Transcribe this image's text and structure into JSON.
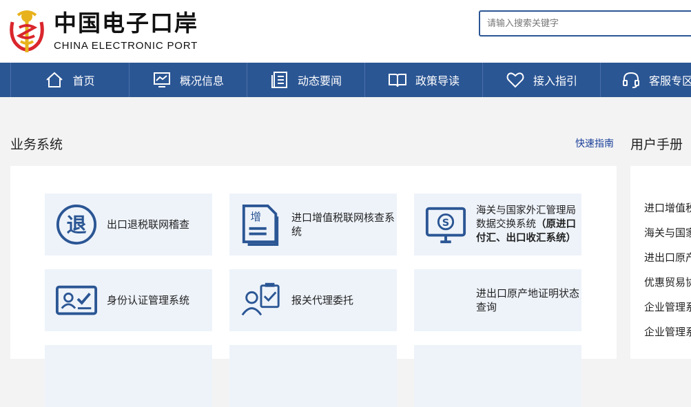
{
  "header": {
    "logo_cn": "中国电子口岸",
    "logo_en": "CHINA ELECTRONIC PORT",
    "search_placeholder": "请输入搜索关键字"
  },
  "nav": {
    "items": [
      {
        "label": "首页",
        "icon": "home-icon"
      },
      {
        "label": "概况信息",
        "icon": "chart-monitor-icon"
      },
      {
        "label": "动态要闻",
        "icon": "document-list-icon"
      },
      {
        "label": "政策导读",
        "icon": "open-book-icon"
      },
      {
        "label": "接入指引",
        "icon": "heart-icon"
      },
      {
        "label": "客服专区",
        "icon": "headset-icon"
      }
    ]
  },
  "business": {
    "title": "业务系统",
    "quick_link": "快速指南",
    "tiles": [
      {
        "label": "出口退税联网稽查",
        "icon": "tui-refund-icon"
      },
      {
        "label": "进口增值税联网核查系统",
        "icon": "vat-document-icon"
      },
      {
        "label_line1": "海关与国家外汇管理局数据交换系统",
        "label_bold": "（原进口付汇、出口收汇系统）",
        "icon": "monitor-currency-icon"
      },
      {
        "label": "身份认证管理系统",
        "icon": "id-card-check-icon"
      },
      {
        "label": "报关代理委托",
        "icon": "person-clipboard-icon"
      },
      {
        "label": "进出口原产地证明状态查询",
        "icon": ""
      }
    ]
  },
  "manual": {
    "title": "用户手册",
    "items": [
      "进口增值税",
      "海关与国家",
      "进出口原产",
      "优惠贸易协",
      "企业管理系",
      "企业管理系"
    ]
  },
  "colors": {
    "brand_blue": "#2b5694",
    "tile_bg": "#eef3fa",
    "page_bg": "#f3f3f3",
    "logo_red": "#d9262c",
    "logo_gold": "#e8b21d"
  }
}
